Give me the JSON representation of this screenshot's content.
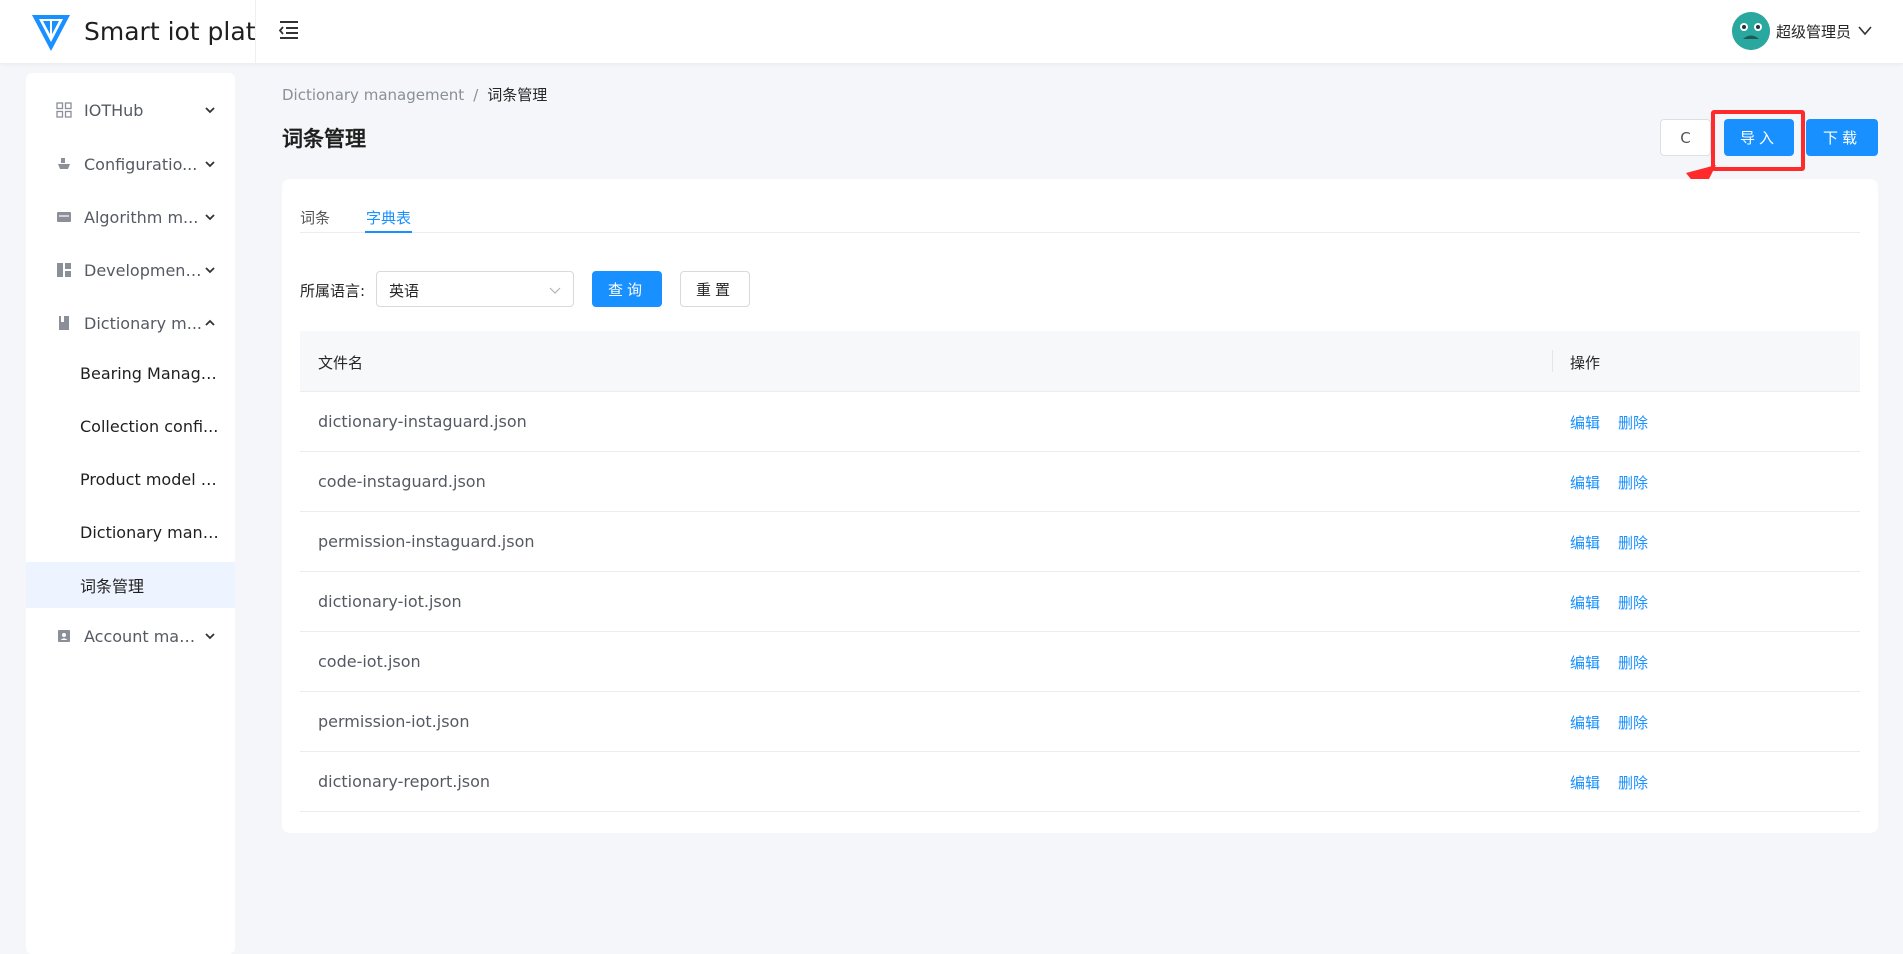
{
  "app": {
    "title": "Smart iot platfor"
  },
  "user": {
    "name": "超级管理员"
  },
  "sidebar": {
    "items": [
      {
        "label": "IOTHub",
        "icon": "grid-icon"
      },
      {
        "label": "Configuratio...",
        "icon": "ship-icon"
      },
      {
        "label": "Algorithm m...",
        "icon": "algorithm-icon"
      },
      {
        "label": "Development...",
        "icon": "development-icon"
      },
      {
        "label": "Dictionary m...",
        "icon": "book-icon"
      },
      {
        "label": "Account man...",
        "icon": "account-icon"
      }
    ],
    "sub_items": [
      {
        "label": "Bearing Manage..."
      },
      {
        "label": "Collection confi..."
      },
      {
        "label": "Product model n..."
      },
      {
        "label": "Dictionary mana..."
      },
      {
        "label": "词条管理"
      }
    ]
  },
  "breadcrumb": {
    "parent": "Dictionary management",
    "separator": "/",
    "current": "词条管理"
  },
  "page": {
    "title": "词条管理",
    "refresh_icon": "C",
    "import_label": "导入",
    "download_label": "下载"
  },
  "tabs": [
    {
      "label": "词条"
    },
    {
      "label": "字典表"
    }
  ],
  "filter": {
    "language_label": "所属语言:",
    "language_value": "英语",
    "query_label": "查询",
    "reset_label": "重置"
  },
  "table": {
    "columns": [
      "文件名",
      "操作"
    ],
    "edit_label": "编辑",
    "delete_label": "删除",
    "rows": [
      {
        "name": "dictionary-instaguard.json"
      },
      {
        "name": "code-instaguard.json"
      },
      {
        "name": "permission-instaguard.json"
      },
      {
        "name": "dictionary-iot.json"
      },
      {
        "name": "code-iot.json"
      },
      {
        "name": "permission-iot.json"
      },
      {
        "name": "dictionary-report.json"
      }
    ]
  },
  "colors": {
    "primary": "#1890ff",
    "highlight": "#ff2a2a",
    "active_menu_bg": "#eef4ff"
  }
}
